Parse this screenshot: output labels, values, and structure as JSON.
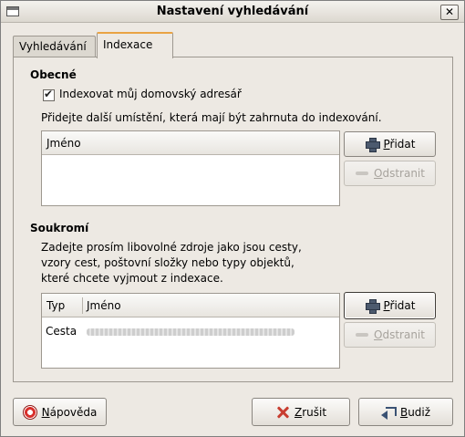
{
  "window": {
    "title": "Nastavení vyhledávání",
    "close_glyph": "✕"
  },
  "tabs": [
    {
      "label": "Vyhledávání",
      "active": false
    },
    {
      "label": "Indexace",
      "active": true
    }
  ],
  "general": {
    "title": "Obecné",
    "index_home_label": "Indexovat můj domovský adresář",
    "index_home_checked": true,
    "add_locations_text": "Přidejte další umístění, která mají být zahrnuta do indexování.",
    "list_header_name": "Jméno",
    "add_button": {
      "mnemonic": "P",
      "rest": "řidat"
    },
    "remove_button": {
      "mnemonic": "O",
      "rest": "dstranit"
    }
  },
  "privacy": {
    "title": "Soukromí",
    "description_line1": "Zadejte prosím libovolné zdroje jako jsou cesty,",
    "description_line2": "vzory cest, poštovní složky nebo typy objektů,",
    "description_line3": "které chcete vyjmout z indexace.",
    "list_header_type": "Typ",
    "list_header_name": "Jméno",
    "rows": [
      {
        "type": "Cesta"
      }
    ],
    "add_button": {
      "mnemonic": "P",
      "rest": "řidat"
    },
    "remove_button": {
      "mnemonic": "O",
      "rest": "dstranit"
    }
  },
  "footer": {
    "help_button": {
      "mnemonic": "N",
      "rest": "ápověda"
    },
    "cancel_button": {
      "mnemonic": "Z",
      "rest": "rušit"
    },
    "ok_button": {
      "mnemonic": "B",
      "rest": "udiž"
    }
  },
  "icons": {
    "window": "window-icon",
    "close": "close-icon",
    "add": "plus-icon",
    "remove": "minus-icon",
    "help": "lifebuoy-icon",
    "cancel": "cancel-x-icon",
    "ok": "return-arrow-icon"
  }
}
